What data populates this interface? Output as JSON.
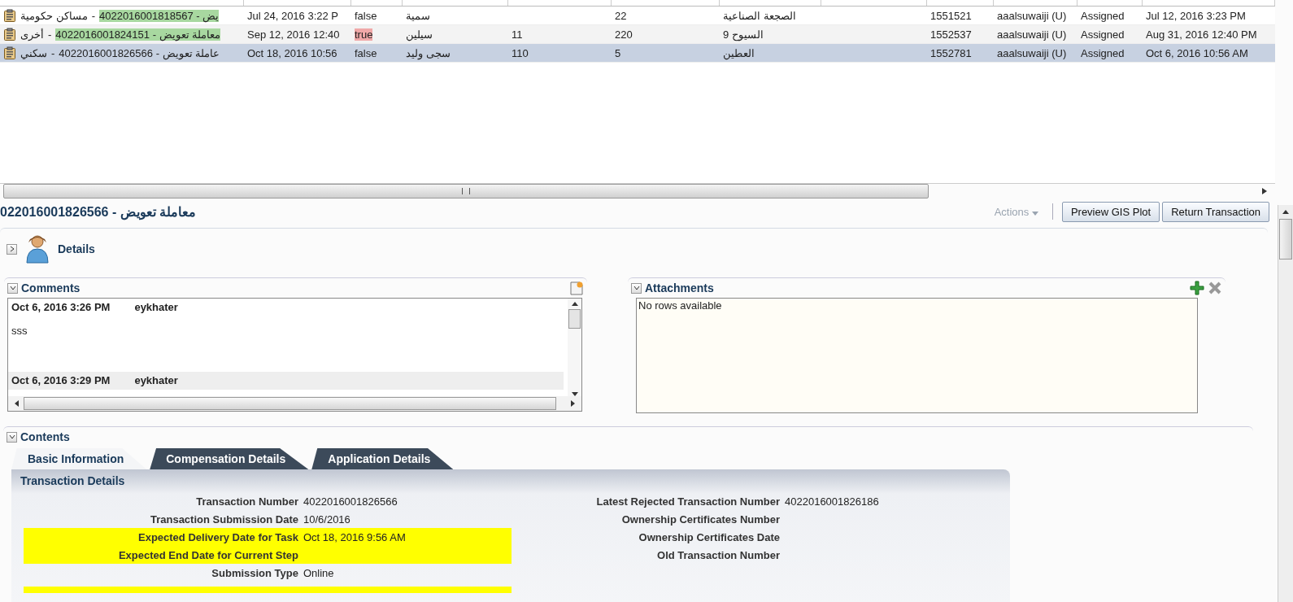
{
  "table": {
    "rows": [
      {
        "selected": false,
        "type_label": "مساكن حكومية",
        "sep": "-",
        "title": "4022016001818567 - يض",
        "highlighted": true,
        "date": "Jul 24, 2016 3:22 P",
        "flag": "false",
        "flag_alert": false,
        "name": "سمية",
        "col6": "22",
        "location": "الصجعة الصناعية",
        "plot": "1551521",
        "user": "aaalsuwaiji (U)",
        "status": "Assigned",
        "assigned": "Jul 12, 2016 3:23 PM"
      },
      {
        "selected": false,
        "type_label": "أخرى",
        "sep": "-",
        "title": "4022016001824151 - معاملة تعويض",
        "highlighted": true,
        "date": "Sep 12, 2016 12:40",
        "flag": "true",
        "flag_alert": true,
        "name": "سيلين",
        "col5": "11",
        "col6": "220",
        "location": "السيوح 9",
        "plot": "1552537",
        "user": "aaalsuwaiji (U)",
        "status": "Assigned",
        "assigned": "Aug 31, 2016 12:40 PM"
      },
      {
        "selected": true,
        "type_label": "سكني",
        "sep": "-",
        "title": "4022016001826566 - عاملة تعويض",
        "highlighted": false,
        "date": "Oct 18, 2016 10:56",
        "flag": "false",
        "flag_alert": false,
        "name": "سجى وليد",
        "col5": "110",
        "col6": "5",
        "location": "العطين",
        "plot": "1552781",
        "user": "aaalsuwaiji (U)",
        "status": "Assigned",
        "assigned": "Oct 6, 2016 10:56 AM"
      }
    ]
  },
  "detail": {
    "title": "022016001826566 - معاملة تعويض",
    "actions": {
      "label": "Actions",
      "disabled": true
    },
    "buttons": [
      "Preview GIS Plot",
      "Return Transaction"
    ]
  },
  "details_section": {
    "label": "Details",
    "expanded": false
  },
  "comments": {
    "label": "Comments",
    "expanded": true,
    "items": [
      {
        "date": "Oct 6, 2016 3:26 PM",
        "author": "eykhater",
        "body": "sss"
      },
      {
        "date": "Oct 6, 2016 3:29 PM",
        "author": "eykhater"
      }
    ]
  },
  "attachments": {
    "label": "Attachments",
    "expanded": true,
    "empty_text": "No rows available"
  },
  "contents": {
    "label": "Contents",
    "expanded": true,
    "tabs": [
      {
        "label": "Basic Information",
        "selected": true
      },
      {
        "label": "Compensation Details",
        "selected": false
      },
      {
        "label": "Application Details",
        "selected": false
      }
    ],
    "section_title": "Transaction Details",
    "left_fields": [
      {
        "label": "Transaction Number",
        "value": "4022016001826566",
        "highlighted": false
      },
      {
        "label": "Transaction Submission Date",
        "value": "10/6/2016",
        "highlighted": false
      },
      {
        "label": "Expected Delivery Date for Task",
        "value": "Oct 18, 2016 9:56 AM",
        "highlighted": true
      },
      {
        "label": "Expected End Date for Current Step",
        "highlighted": true
      },
      {
        "label": "Submission Type",
        "value": "Online",
        "highlighted": false
      }
    ],
    "right_fields": [
      {
        "label": "Latest Rejected Transaction Number",
        "value": "4022016001826186"
      },
      {
        "label": "Ownership Certificates Number"
      },
      {
        "label": "Ownership Certificates Date"
      },
      {
        "label": "Old Transaction Number"
      }
    ]
  }
}
